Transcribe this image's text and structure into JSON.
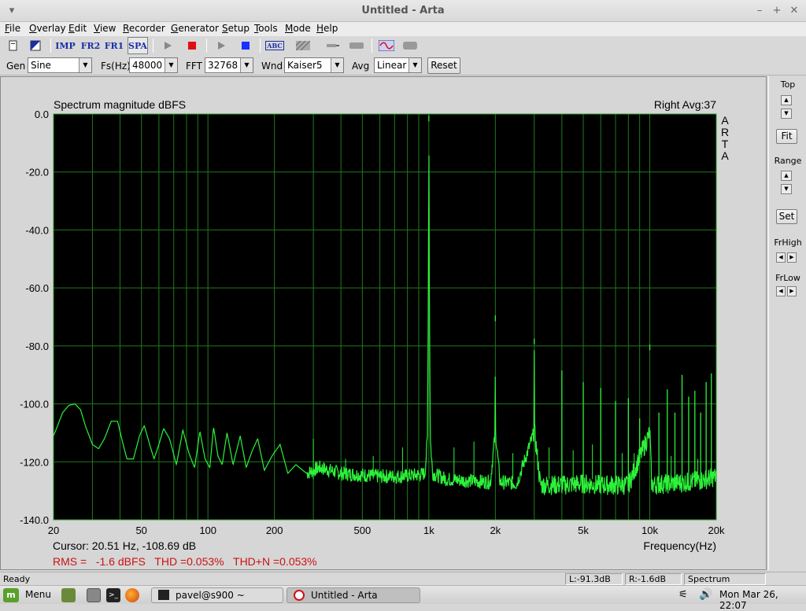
{
  "window": {
    "title": "Untitled - Arta"
  },
  "menu": [
    "File",
    "Overlay",
    "Edit",
    "View",
    "Recorder",
    "Generator",
    "Setup",
    "Tools",
    "Mode",
    "Help"
  ],
  "menu_mnemonics": [
    "F",
    "O",
    "E",
    "V",
    "R",
    "G",
    "S",
    "T",
    "M",
    "H"
  ],
  "toolbar": {
    "imp_label": "IMP",
    "fr2_label": "FR2",
    "fr1_label": "FR1",
    "spa_label": "SPA",
    "abc_label": "ABC"
  },
  "settings": {
    "gen_label": "Gen",
    "gen_value": "Sine",
    "fs_label": "Fs(Hz)",
    "fs_value": "48000",
    "fft_label": "FFT",
    "fft_value": "32768",
    "wnd_label": "Wnd",
    "wnd_value": "Kaiser5",
    "avg_label": "Avg",
    "avg_value": "Linear",
    "reset_label": "Reset"
  },
  "sidebar": {
    "top_label": "Top",
    "fit_label": "Fit",
    "range_label": "Range",
    "set_label": "Set",
    "frhigh_label": "FrHigh",
    "frlow_label": "FrLow"
  },
  "plot": {
    "title": "Spectrum magnitude dBFS",
    "channel_label": "Right  Avg:37",
    "brand_letters": [
      "A",
      "R",
      "T",
      "A"
    ],
    "cursor_text": "Cursor: 20.51 Hz, -108.69 dB",
    "xlabel": "Frequency(Hz)",
    "rms_text": "RMS =   -1.6 dBFS   THD =0.053%   THD+N =0.053%",
    "colors": {
      "background": "#000000",
      "grid": "#1f7a1f",
      "trace": "#2df23a",
      "readout": "#cc1111"
    }
  },
  "chart_data": {
    "type": "line",
    "title": "Spectrum magnitude dBFS",
    "xlabel": "Frequency(Hz)",
    "ylabel": "",
    "xscale": "log",
    "xlim": [
      20,
      20000
    ],
    "ylim": [
      -140,
      0
    ],
    "grid": true,
    "x_ticks": [
      20,
      50,
      100,
      200,
      500,
      1000,
      2000,
      5000,
      10000,
      20000
    ],
    "x_tick_labels": [
      "20",
      "50",
      "100",
      "200",
      "500",
      "1k",
      "2k",
      "5k",
      "10k",
      "20k"
    ],
    "y_ticks": [
      0,
      -20,
      -40,
      -60,
      -80,
      -100,
      -120,
      -140
    ],
    "y_tick_labels": [
      "0.0",
      "-20.0",
      "-40.0",
      "-60.0",
      "-80.0",
      "-100.0",
      "-120.0",
      "-140.0"
    ],
    "series": [
      {
        "points": [
          [
            20,
            -111
          ],
          [
            21,
            -107
          ],
          [
            22,
            -103
          ],
          [
            23.5,
            -100.5
          ],
          [
            25,
            -100
          ],
          [
            26.5,
            -102
          ],
          [
            28,
            -108
          ],
          [
            30,
            -114
          ],
          [
            32,
            -115.5
          ],
          [
            34,
            -112
          ],
          [
            36.5,
            -106
          ],
          [
            39,
            -106
          ],
          [
            41,
            -113
          ],
          [
            43,
            -119
          ],
          [
            46,
            -119
          ],
          [
            49,
            -111
          ],
          [
            51.5,
            -107.5
          ],
          [
            54,
            -113
          ],
          [
            57,
            -119
          ],
          [
            60,
            -114
          ],
          [
            63,
            -108.5
          ],
          [
            67,
            -112
          ],
          [
            72,
            -121
          ],
          [
            77,
            -109
          ],
          [
            82,
            -117
          ],
          [
            87,
            -122
          ],
          [
            92,
            -109.5
          ],
          [
            97,
            -119
          ],
          [
            102,
            -122
          ],
          [
            106,
            -108
          ],
          [
            111,
            -118
          ],
          [
            116,
            -121
          ],
          [
            122,
            -110
          ],
          [
            130,
            -121
          ],
          [
            140,
            -111
          ],
          [
            149,
            -122
          ],
          [
            159,
            -116
          ],
          [
            168,
            -112
          ],
          [
            180,
            -123
          ],
          [
            195,
            -118
          ],
          [
            212,
            -114
          ],
          [
            230,
            -124
          ],
          [
            250,
            -121
          ],
          [
            280,
            -124
          ],
          [
            320,
            -122
          ],
          [
            400,
            -124
          ],
          [
            500,
            -124.5
          ],
          [
            600,
            -125
          ],
          [
            750,
            -125
          ],
          [
            900,
            -124.5
          ],
          [
            960,
            -124
          ],
          [
            985,
            -112
          ],
          [
            995,
            -60
          ],
          [
            1000,
            -0.5
          ],
          [
            1005,
            -60
          ],
          [
            1015,
            -112
          ],
          [
            1040,
            -124
          ],
          [
            1200,
            -126
          ],
          [
            1500,
            -126.5
          ],
          [
            1900,
            -127
          ],
          [
            1995,
            -110
          ],
          [
            2000,
            -69.5
          ],
          [
            2005,
            -110
          ],
          [
            2100,
            -127
          ],
          [
            2500,
            -127.5
          ],
          [
            2990,
            -110
          ],
          [
            3000,
            -77.5
          ],
          [
            3010,
            -110
          ],
          [
            3200,
            -128
          ],
          [
            4000,
            -128
          ],
          [
            5000,
            -127.5
          ],
          [
            6000,
            -128
          ],
          [
            8000,
            -128
          ],
          [
            9990,
            -110
          ],
          [
            10000,
            -79.5
          ],
          [
            10010,
            -110
          ],
          [
            10200,
            -128
          ],
          [
            12000,
            -127.5
          ],
          [
            15000,
            -127
          ],
          [
            18000,
            -126
          ],
          [
            20000,
            -125
          ]
        ]
      }
    ],
    "harmonics": [
      {
        "f": 1000,
        "level": -0.5
      },
      {
        "f": 2000,
        "level": -69.5
      },
      {
        "f": 3000,
        "level": -77.5
      },
      {
        "f": 4000,
        "level": -88.5
      },
      {
        "f": 5000,
        "level": -92.5
      },
      {
        "f": 6000,
        "level": -94.5
      },
      {
        "f": 7000,
        "level": -99
      },
      {
        "f": 8000,
        "level": -98
      },
      {
        "f": 9000,
        "level": -105
      },
      {
        "f": 10000,
        "level": -79.5
      },
      {
        "f": 11000,
        "level": -103
      },
      {
        "f": 12000,
        "level": -95
      },
      {
        "f": 13000,
        "level": -103
      },
      {
        "f": 14000,
        "level": -90
      },
      {
        "f": 15000,
        "level": -97.5
      },
      {
        "f": 16000,
        "level": -95.5
      },
      {
        "f": 17000,
        "level": -103
      },
      {
        "f": 18000,
        "level": -92.5
      },
      {
        "f": 19000,
        "level": -89.5
      }
    ],
    "small_peaks": [
      {
        "f": 300,
        "level": -112
      },
      {
        "f": 420,
        "level": -119
      },
      {
        "f": 560,
        "level": -118
      },
      {
        "f": 760,
        "level": -115
      },
      {
        "f": 1300,
        "level": -115
      },
      {
        "f": 1600,
        "level": -113
      },
      {
        "f": 2400,
        "level": -117
      },
      {
        "f": 3500,
        "level": -115
      },
      {
        "f": 4500,
        "level": -116
      },
      {
        "f": 5500,
        "level": -114
      },
      {
        "f": 7500,
        "level": -117
      },
      {
        "f": 8500,
        "level": -117
      },
      {
        "f": 12500,
        "level": -118
      },
      {
        "f": 16500,
        "level": -119
      }
    ]
  },
  "status": {
    "ready": "Ready",
    "left_level": "L:-91.3dB",
    "right_level": "R:-1.6dB",
    "mode": "Spectrum Analyzer"
  },
  "taskbar": {
    "menu_label": "Menu",
    "tasks": [
      "pavel@s900 ~",
      "Untitled - Arta"
    ],
    "clock": "Mon Mar 26, 22:07"
  }
}
